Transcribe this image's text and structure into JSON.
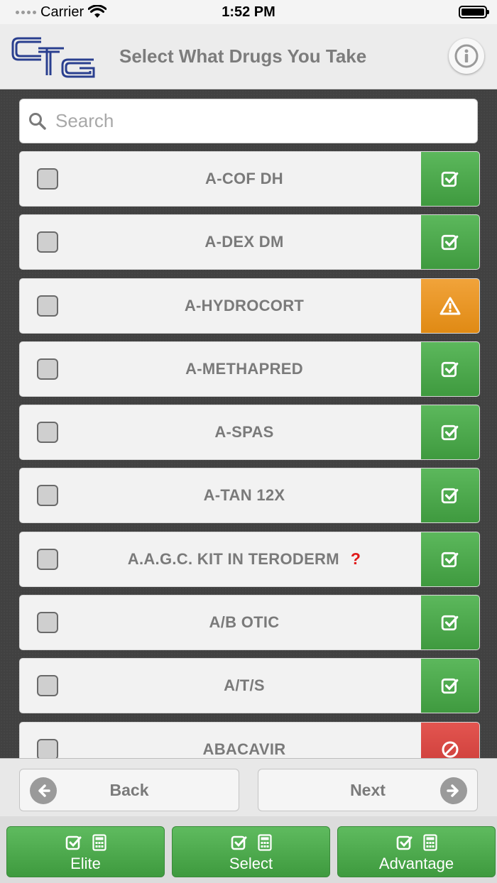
{
  "status_bar": {
    "carrier": "Carrier",
    "time": "1:52 PM"
  },
  "header": {
    "title": "Select What Drugs You Take",
    "logo_icon": "cfg-logo",
    "info_icon": "info-icon"
  },
  "search": {
    "placeholder": "Search",
    "value": ""
  },
  "drugs": [
    {
      "name": "A-COF DH",
      "status": "covered",
      "status_icon": "check-icon",
      "note": ""
    },
    {
      "name": "A-DEX DM",
      "status": "covered",
      "status_icon": "check-icon",
      "note": ""
    },
    {
      "name": "A-HYDROCORT",
      "status": "warning",
      "status_icon": "warning-icon",
      "note": ""
    },
    {
      "name": "A-METHAPRED",
      "status": "covered",
      "status_icon": "check-icon",
      "note": ""
    },
    {
      "name": "A-SPAS",
      "status": "covered",
      "status_icon": "check-icon",
      "note": ""
    },
    {
      "name": "A-TAN 12X",
      "status": "covered",
      "status_icon": "check-icon",
      "note": ""
    },
    {
      "name": "A.A.G.C. KIT IN TERODERM",
      "status": "covered",
      "status_icon": "check-icon",
      "note": "?"
    },
    {
      "name": "A/B OTIC",
      "status": "covered",
      "status_icon": "check-icon",
      "note": ""
    },
    {
      "name": "A/T/S",
      "status": "covered",
      "status_icon": "check-icon",
      "note": ""
    },
    {
      "name": "ABACAVIR",
      "status": "not-covered",
      "status_icon": "blocked-icon",
      "note": ""
    }
  ],
  "nav": {
    "back_label": "Back",
    "next_label": "Next"
  },
  "tabs": [
    {
      "label": "Elite"
    },
    {
      "label": "Select"
    },
    {
      "label": "Advantage"
    }
  ],
  "colors": {
    "covered": "#4cae4c",
    "warning": "#f0a030",
    "not_covered": "#d9534f",
    "question_mark": "#e01a1a",
    "logo_blue": "#2a3f8f"
  }
}
